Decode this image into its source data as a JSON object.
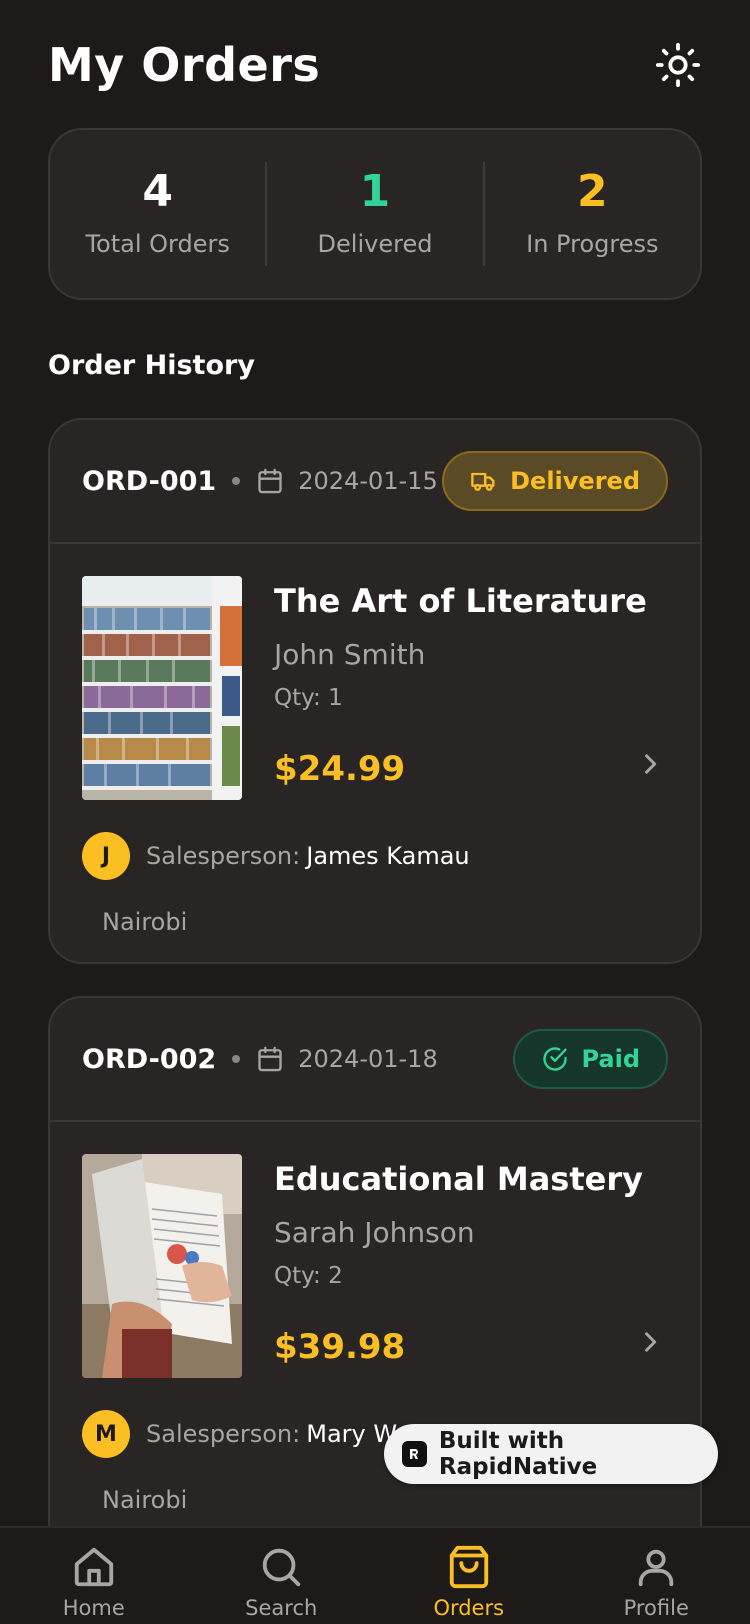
{
  "header": {
    "title": "My Orders",
    "theme_icon": "sun-icon"
  },
  "stats": [
    {
      "value": "4",
      "label": "Total Orders",
      "color": "#ffffff"
    },
    {
      "value": "1",
      "label": "Delivered",
      "color": "#34d399"
    },
    {
      "value": "2",
      "label": "In Progress",
      "color": "#fbbf24"
    }
  ],
  "section_title": "Order History",
  "orders": [
    {
      "id": "ORD-001",
      "date": "2024-01-15",
      "status": "Delivered",
      "status_icon": "truck-icon",
      "title": "The Art of Literature",
      "author": "John Smith",
      "qty": "Qty: 1",
      "price": "$24.99",
      "salesperson_initial": "J",
      "salesperson_label": "Salesperson:",
      "salesperson_name": "James Kamau",
      "location": "Nairobi"
    },
    {
      "id": "ORD-002",
      "date": "2024-01-18",
      "status": "Paid",
      "status_icon": "check-circle-icon",
      "title": "Educational Mastery",
      "author": "Sarah Johnson",
      "qty": "Qty: 2",
      "price": "$39.98",
      "salesperson_initial": "M",
      "salesperson_label": "Salesperson:",
      "salesperson_name": "Mary Wa",
      "location": "Nairobi"
    }
  ],
  "built_with": "Built with RapidNative",
  "tabs": [
    {
      "label": "Home",
      "icon": "home-icon",
      "active": false
    },
    {
      "label": "Search",
      "icon": "search-icon",
      "active": false
    },
    {
      "label": "Orders",
      "icon": "shopping-bag-icon",
      "active": true
    },
    {
      "label": "Profile",
      "icon": "user-icon",
      "active": false
    }
  ],
  "colors": {
    "accent": "#fbbf24",
    "success": "#34d399",
    "background": "#1e1a19",
    "card": "#282524"
  }
}
